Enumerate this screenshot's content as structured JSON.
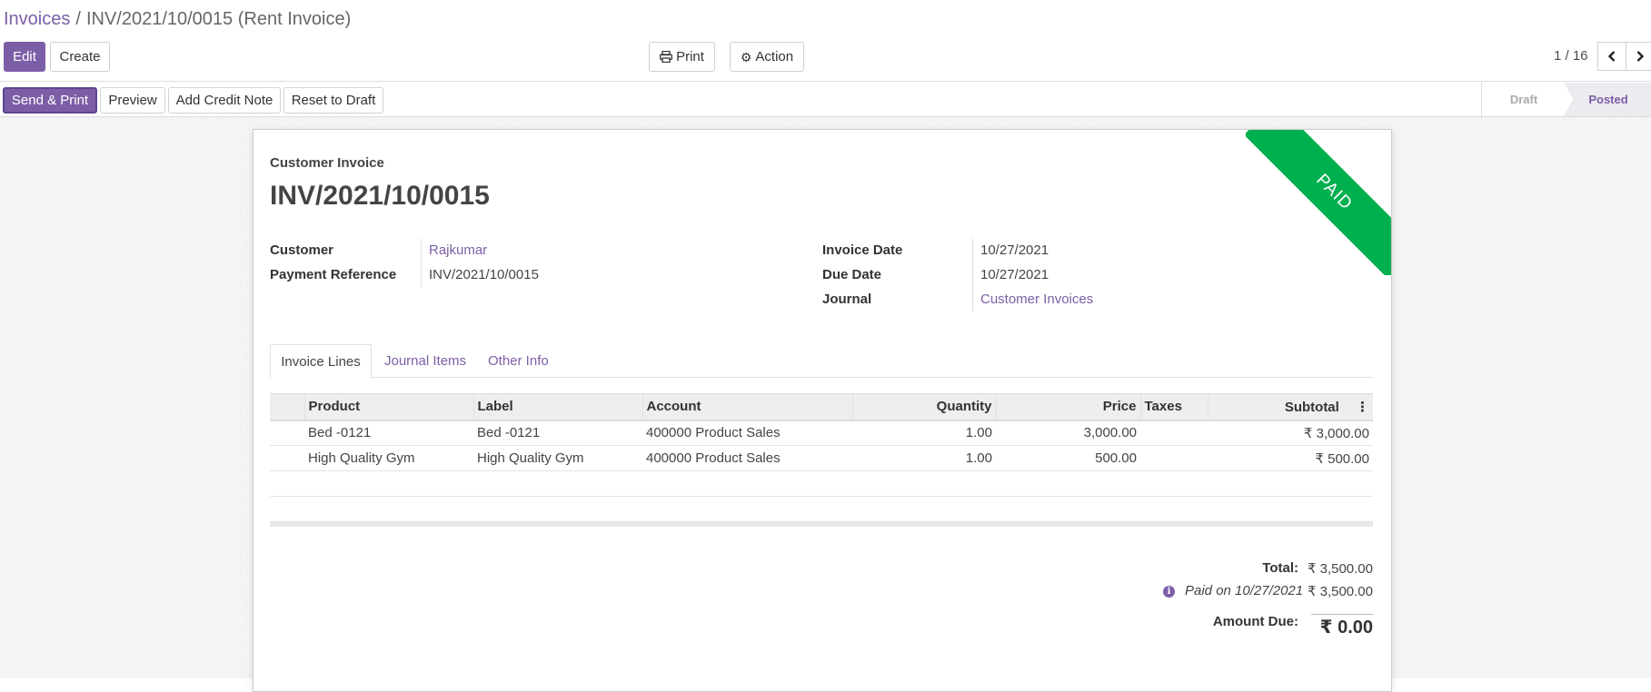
{
  "breadcrumb": {
    "parent": "Invoices",
    "separator": "/",
    "current": "INV/2021/10/0015 (Rent Invoice)"
  },
  "toolbar": {
    "edit": "Edit",
    "create": "Create",
    "print": "Print",
    "action": "Action"
  },
  "pager": {
    "value": "1 / 16"
  },
  "status_buttons": {
    "send_print": "Send & Print",
    "preview": "Preview",
    "add_credit_note": "Add Credit Note",
    "reset_to_draft": "Reset to Draft"
  },
  "stages": {
    "draft": "Draft",
    "posted": "Posted",
    "current": "Posted"
  },
  "invoice": {
    "ribbon": "PAID",
    "type": "Customer Invoice",
    "name": "INV/2021/10/0015",
    "customer_label": "Customer",
    "customer": "Rajkumar",
    "payment_ref_label": "Payment Reference",
    "payment_ref": "INV/2021/10/0015",
    "invoice_date_label": "Invoice Date",
    "invoice_date": "10/27/2021",
    "due_date_label": "Due Date",
    "due_date": "10/27/2021",
    "journal_label": "Journal",
    "journal": "Customer Invoices"
  },
  "tabs": [
    "Invoice Lines",
    "Journal Items",
    "Other Info"
  ],
  "lines": {
    "headers": {
      "product": "Product",
      "label": "Label",
      "account": "Account",
      "quantity": "Quantity",
      "price": "Price",
      "taxes": "Taxes",
      "subtotal": "Subtotal"
    },
    "rows": [
      {
        "product": "Bed -0121",
        "label": "Bed -0121",
        "account": "400000 Product Sales",
        "quantity": "1.00",
        "price": "3,000.00",
        "taxes": "",
        "subtotal": "₹ 3,000.00"
      },
      {
        "product": "High Quality Gym",
        "label": "High Quality Gym",
        "account": "400000 Product Sales",
        "quantity": "1.00",
        "price": "500.00",
        "taxes": "",
        "subtotal": "₹ 500.00"
      }
    ]
  },
  "totals": {
    "total_label": "Total:",
    "total": "₹ 3,500.00",
    "paid_on": "Paid on 10/27/2021",
    "paid_amount": "₹ 3,500.00",
    "amount_due_label": "Amount Due:",
    "amount_due": "₹ 0.00"
  },
  "colors": {
    "brand": "#7c5ea6",
    "paid_ribbon": "#00b04f"
  }
}
